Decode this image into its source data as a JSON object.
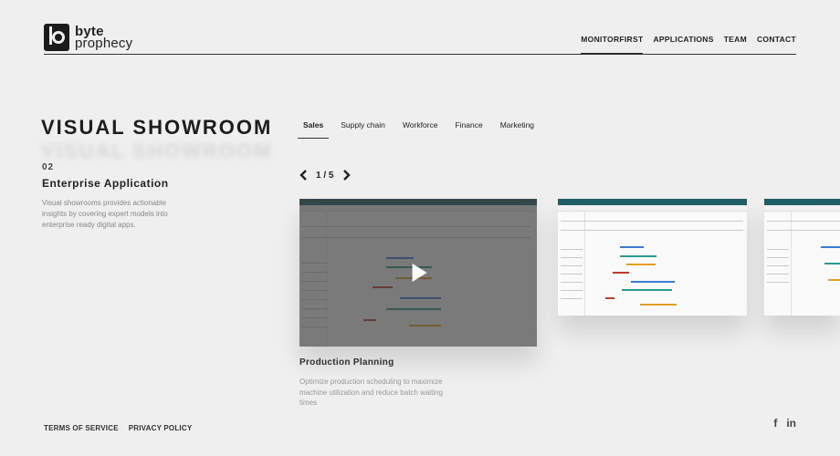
{
  "brand": {
    "line1": "byte",
    "line2": "prophecy"
  },
  "nav": [
    {
      "label": "MONITORFIRST",
      "active": true
    },
    {
      "label": "APPLICATIONS"
    },
    {
      "label": "TEAM"
    },
    {
      "label": "CONTACT"
    }
  ],
  "hero": {
    "title": "VISUAL SHOWROOM",
    "index": "02",
    "app_name": "Enterprise Application",
    "description": "Visual showrooms provides actionable insights by covering expert models into enterprise ready digital apps."
  },
  "tabs": [
    {
      "label": "Sales",
      "active": true
    },
    {
      "label": "Supply chain"
    },
    {
      "label": "Workforce"
    },
    {
      "label": "Finance"
    },
    {
      "label": "Marketing"
    }
  ],
  "pager": {
    "text": "1 / 5"
  },
  "cards": [
    {
      "title": "Production Planning",
      "description": "Optimize production scheduling to maximize machine utilization and reduce batch waiting times"
    }
  ],
  "footer": {
    "terms": "TERMS OF SERVICE",
    "privacy": "PRIVACY POLICY"
  },
  "social": {
    "facebook": "f",
    "linkedin": "in"
  },
  "colors": {
    "background": "#efefef",
    "accent": "#1f5f67",
    "text": "#1a1a1a"
  },
  "icons": {
    "prev": "chevron-left-icon",
    "next": "chevron-right-icon",
    "play": "play-icon"
  }
}
